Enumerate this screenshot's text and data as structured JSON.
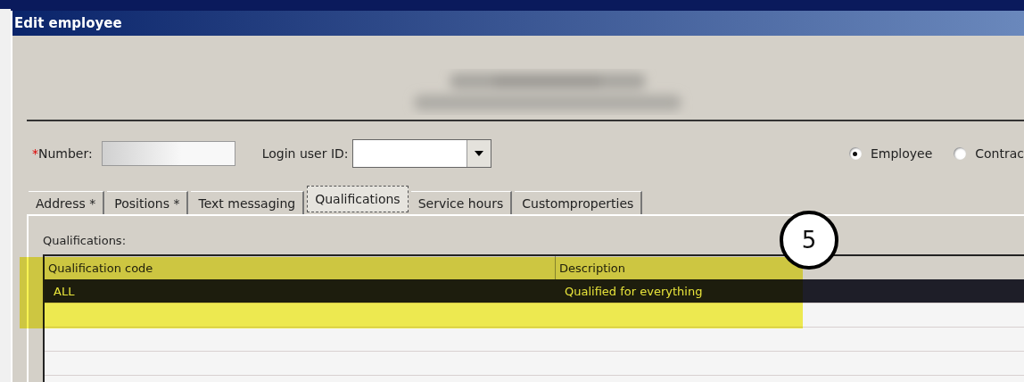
{
  "window": {
    "title": "Edit employee"
  },
  "fields": [
    {
      "kind": "text",
      "label": "Number:",
      "required_mark": "*"
    },
    {
      "kind": "combo",
      "label": "Login user ID:"
    }
  ],
  "radios": [
    {
      "label": "Employee",
      "selected": true
    },
    {
      "label": "Contrac",
      "selected": false
    }
  ],
  "tabs": [
    {
      "label": "Address *",
      "selected": false
    },
    {
      "label": "Positions *",
      "selected": false
    },
    {
      "label": "Text messaging",
      "selected": false
    },
    {
      "label": "Qualifications",
      "selected": true
    },
    {
      "label": "Service hours",
      "selected": false
    },
    {
      "label": "Customproperties",
      "selected": false
    }
  ],
  "qualifications": {
    "label": "Qualifications:",
    "columns": [
      "Qualification code",
      "Description"
    ],
    "rows": [
      {
        "cells": [
          "ALL",
          "Qualified for everything"
        ],
        "selected": true
      }
    ]
  },
  "callout": {
    "label": "5"
  }
}
